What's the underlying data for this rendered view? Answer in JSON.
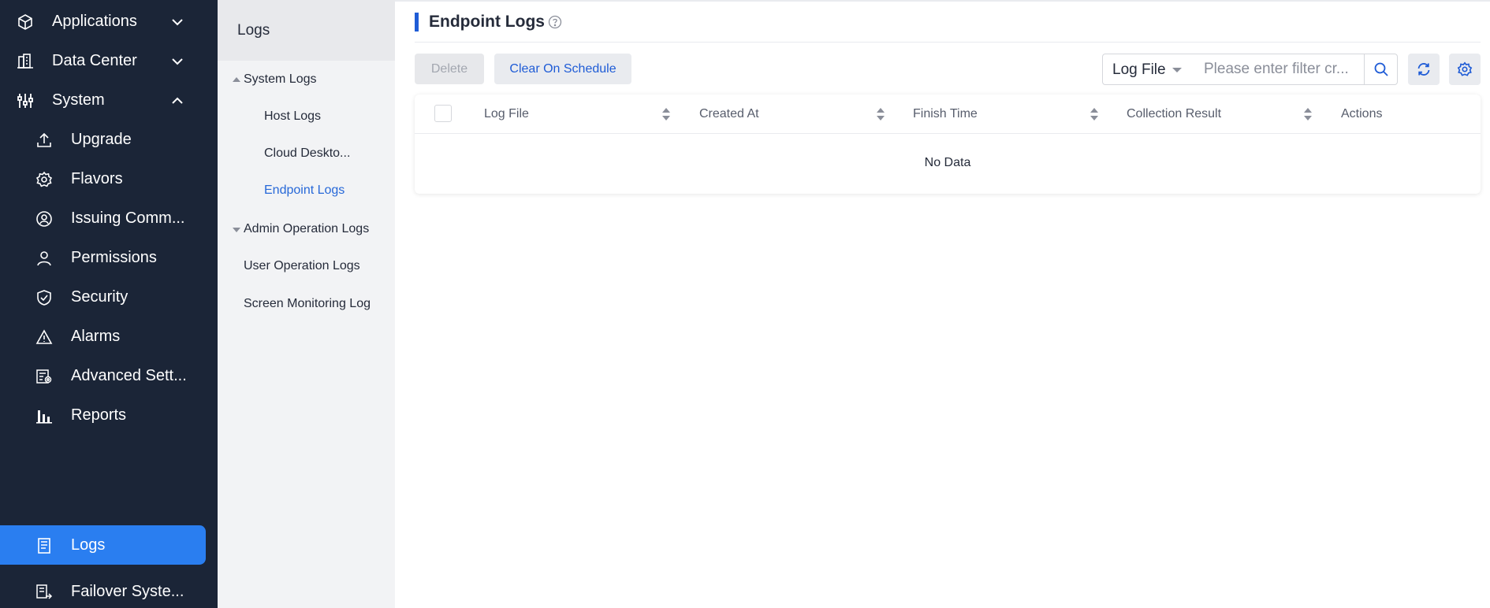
{
  "nav": {
    "items": [
      {
        "label": "Applications",
        "icon": "cube-icon"
      },
      {
        "label": "Data Center",
        "icon": "building-icon"
      },
      {
        "label": "System",
        "icon": "sliders-icon"
      },
      {
        "label": "Upgrade",
        "icon": "upload-icon"
      },
      {
        "label": "Flavors",
        "icon": "gear-icon"
      },
      {
        "label": "Issuing Comm...",
        "icon": "at-circle-icon"
      },
      {
        "label": "Permissions",
        "icon": "user-icon"
      },
      {
        "label": "Security",
        "icon": "shield-icon"
      },
      {
        "label": "Alarms",
        "icon": "warning-icon"
      },
      {
        "label": "Advanced Sett...",
        "icon": "advanced-settings-icon"
      },
      {
        "label": "Reports",
        "icon": "bar-chart-icon"
      },
      {
        "label": "Logs",
        "icon": "document-icon"
      },
      {
        "label": "Failover Syste...",
        "icon": "failover-icon"
      }
    ]
  },
  "tree": {
    "title": "Logs",
    "system_logs": "System Logs",
    "host_logs": "Host Logs",
    "cloud_desktop": "Cloud Deskto...",
    "endpoint_logs": "Endpoint Logs",
    "admin_operation_logs": "Admin Operation Logs",
    "user_operation_logs": "User Operation Logs",
    "screen_monitoring_log": "Screen Monitoring Log"
  },
  "main": {
    "title": "Endpoint Logs",
    "delete_label": "Delete",
    "clear_label": "Clear On Schedule",
    "filter_select": "Log File",
    "search_placeholder": "Please enter filter cr...",
    "columns": [
      "Log File",
      "Created At",
      "Finish Time",
      "Collection Result",
      "Actions"
    ],
    "empty_text": "No Data"
  },
  "colors": {
    "nav_bg": "#1b2537",
    "accent": "#2a7ef0",
    "link": "#2768d8"
  }
}
